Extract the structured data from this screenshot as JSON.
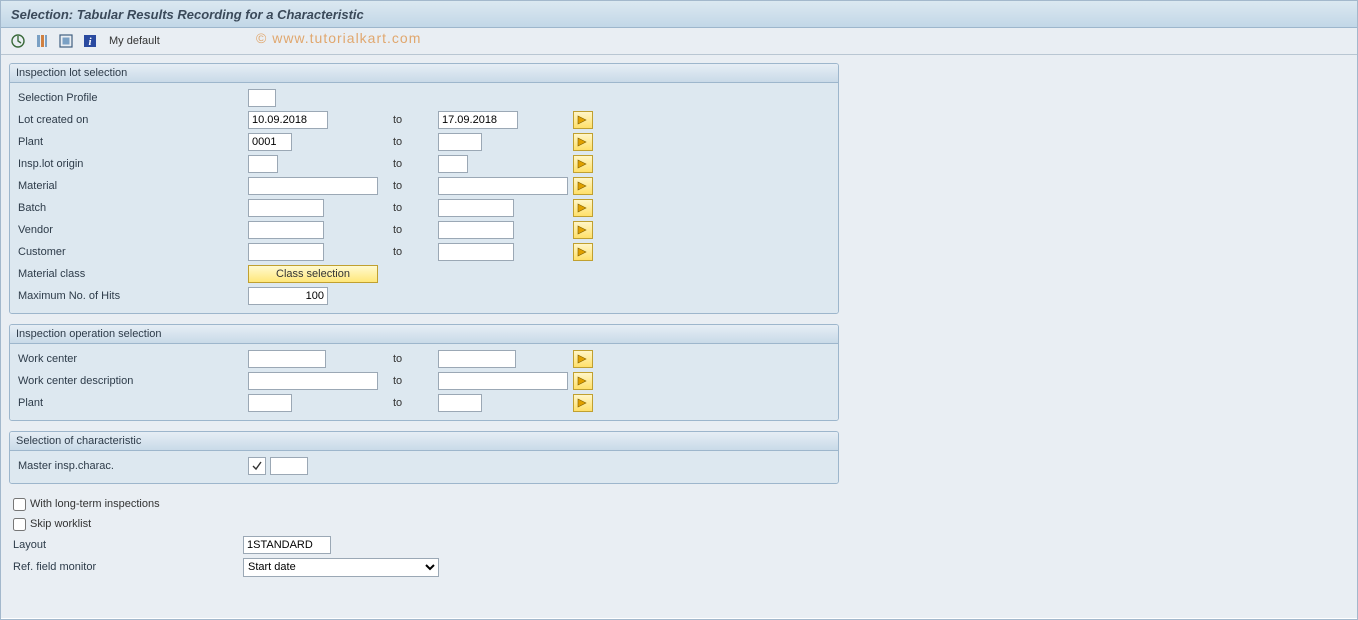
{
  "title": "Selection: Tabular Results Recording for a Characteristic",
  "toolbar": {
    "my_default": "My default"
  },
  "watermark": "© www.tutorialkart.com",
  "group1": {
    "header": "Inspection lot selection",
    "rows": {
      "selection_profile": {
        "label": "Selection Profile",
        "low": ""
      },
      "lot_created": {
        "label": "Lot created on",
        "low": "10.09.2018",
        "to": "to",
        "high": "17.09.2018"
      },
      "plant": {
        "label": "Plant",
        "low": "0001",
        "to": "to",
        "high": ""
      },
      "origin": {
        "label": "Insp.lot origin",
        "low": "",
        "to": "to",
        "high": ""
      },
      "material": {
        "label": "Material",
        "low": "",
        "to": "to",
        "high": ""
      },
      "batch": {
        "label": "Batch",
        "low": "",
        "to": "to",
        "high": ""
      },
      "vendor": {
        "label": "Vendor",
        "low": "",
        "to": "to",
        "high": ""
      },
      "customer": {
        "label": "Customer",
        "low": "",
        "to": "to",
        "high": ""
      },
      "material_class": {
        "label": "Material class",
        "button": "Class selection"
      },
      "max_hits": {
        "label": "Maximum No. of Hits",
        "value": "100"
      }
    }
  },
  "group2": {
    "header": "Inspection operation selection",
    "rows": {
      "work_center": {
        "label": "Work center",
        "low": "",
        "to": "to",
        "high": ""
      },
      "wc_desc": {
        "label": "Work center description",
        "low": "",
        "to": "to",
        "high": ""
      },
      "plant2": {
        "label": "Plant",
        "low": "",
        "to": "to",
        "high": ""
      }
    }
  },
  "group3": {
    "header": "Selection of characteristic",
    "rows": {
      "master_charac": {
        "label": "Master insp.charac.",
        "value": ""
      }
    }
  },
  "checkboxes": {
    "long_term": "With long-term inspections",
    "skip_worklist": "Skip worklist"
  },
  "layout_row": {
    "label": "Layout",
    "value": "1STANDARD"
  },
  "ref_row": {
    "label": "Ref. field monitor",
    "value": "Start date"
  }
}
